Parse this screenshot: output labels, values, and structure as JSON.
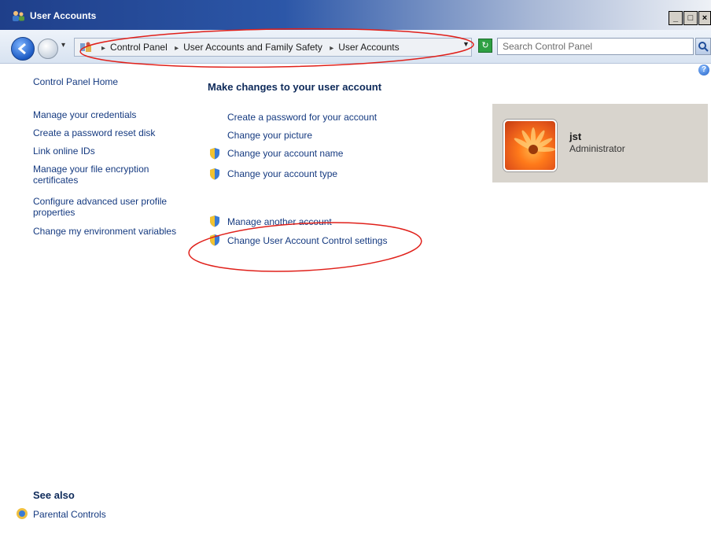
{
  "window": {
    "title": "User Accounts",
    "controls": [
      "_",
      "□",
      "×"
    ]
  },
  "navigation": {
    "breadcrumbs": [
      "Control Panel",
      "User Accounts and Family Safety",
      "User Accounts"
    ],
    "search_placeholder": "Search Control Panel"
  },
  "sidebar": {
    "home": "Control Panel Home",
    "links": [
      "Manage your credentials",
      "Create a password reset disk",
      "Link online IDs",
      "Manage your file encryption certificates",
      "Configure advanced user profile properties",
      "Change my environment variables"
    ],
    "see_also": "See also",
    "parental_controls": "Parental Controls"
  },
  "main": {
    "heading": "Make changes to your user account",
    "tasks": [
      {
        "label": "Create a password for your account",
        "shield": false
      },
      {
        "label": "Change your picture",
        "shield": false
      },
      {
        "label": "Change your account name",
        "shield": true
      },
      {
        "label": "Change your account type",
        "shield": true
      },
      {
        "label": "Manage another account",
        "shield": true
      },
      {
        "label": "Change User Account Control settings",
        "shield": true
      }
    ]
  },
  "user": {
    "name": "jst",
    "role": "Administrator"
  },
  "colors": {
    "annotation": "#e0201a",
    "link": "#153a80",
    "tile_bg": "#d8d4cd"
  }
}
